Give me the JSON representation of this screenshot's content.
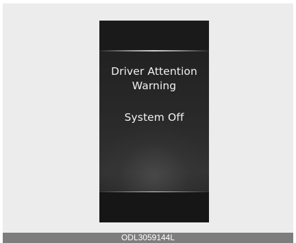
{
  "display": {
    "message_line1": "Driver Attention",
    "message_line2": "Warning",
    "status": "System Off"
  },
  "caption": {
    "code": "ODL3059144L"
  },
  "colors": {
    "frame_background": "#ececec",
    "display_background": "#232323",
    "text": "#f2f2f2",
    "caption_bar": "#7d7d7d"
  }
}
